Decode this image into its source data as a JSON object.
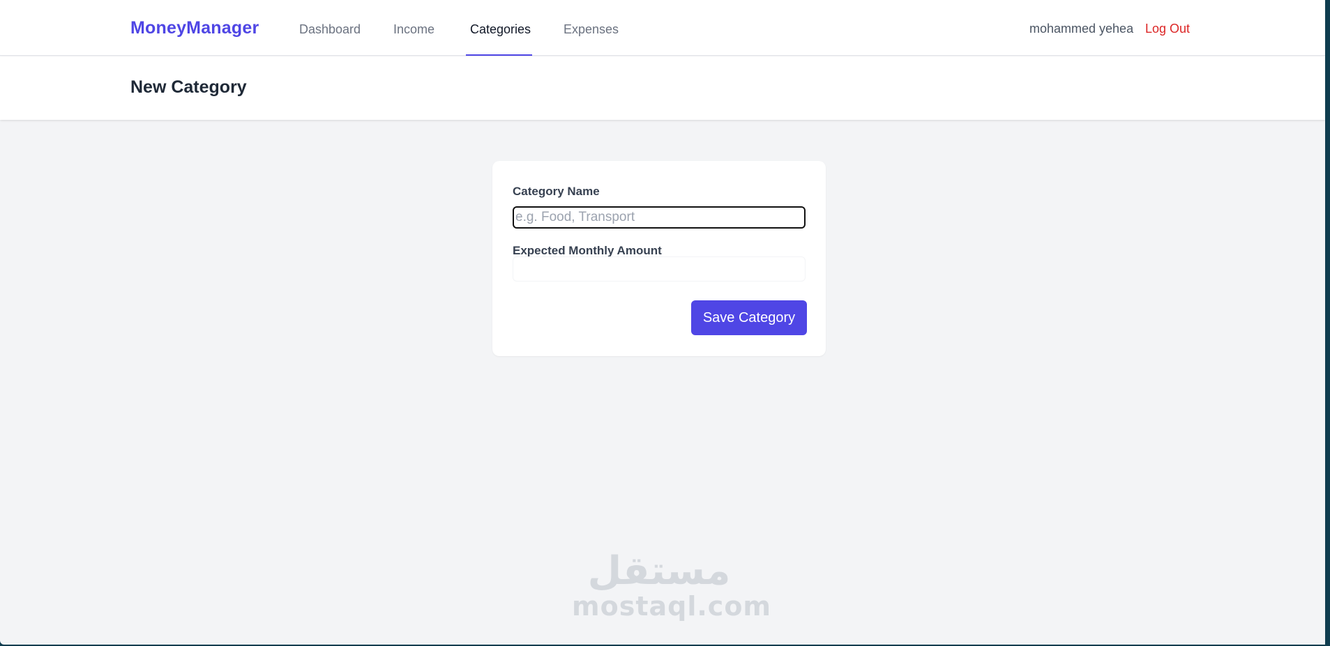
{
  "nav": {
    "brand": "MoneyManager",
    "links": [
      {
        "label": "Dashboard",
        "active": false
      },
      {
        "label": "Income",
        "active": false
      },
      {
        "label": "Categories",
        "active": true
      },
      {
        "label": "Expenses",
        "active": false
      }
    ],
    "user_name": "mohammed yehea",
    "logout_label": "Log Out"
  },
  "header": {
    "title": "New Category"
  },
  "form": {
    "name_label": "Category Name",
    "name_placeholder": "e.g. Food, Transport",
    "name_value": "",
    "amount_label": "Expected Monthly Amount",
    "amount_value": "",
    "save_label": "Save Category"
  },
  "watermark": {
    "arabic": "مستقل",
    "latin": "mostaql.com"
  },
  "colors": {
    "brand": "#4f46e5",
    "logout": "#dc2626",
    "background": "#f3f4f6"
  }
}
